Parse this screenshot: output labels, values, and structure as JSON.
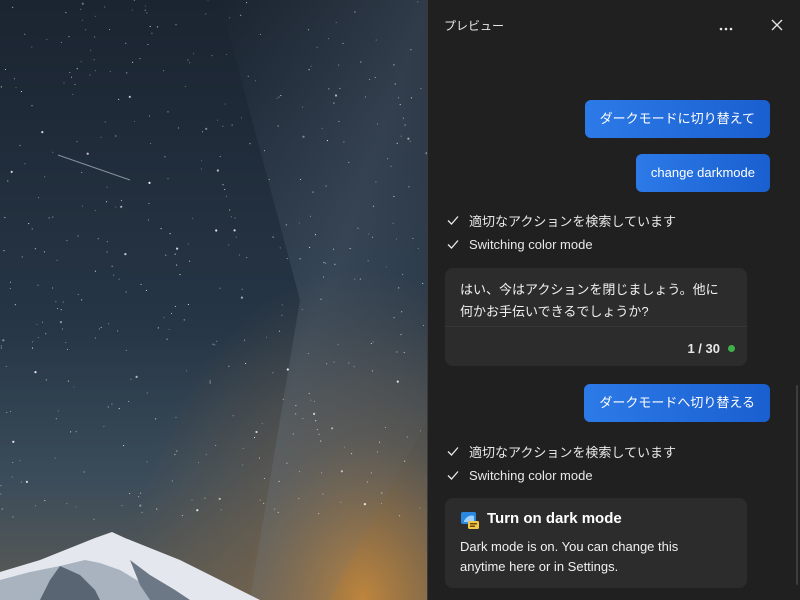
{
  "pane": {
    "title": "プレビュー",
    "more_icon": "more-horizontal-icon",
    "close_icon": "close-icon"
  },
  "conversation": {
    "user_message_1": "ダークモードに切り替えて",
    "user_message_2": "change darkmode",
    "steps_1": [
      "適切なアクションを検索しています",
      "Switching color mode"
    ],
    "bot_reply": {
      "line1": "はい、今はアクションを閉じましょう。他に",
      "line2": "何かお手伝いできるでしょうか?",
      "counter": "1 / 30",
      "status_color": "#3fb14a"
    },
    "user_message_3": "ダークモードへ切り替える",
    "steps_2": [
      "適切なアクションを検索しています",
      "Switching color mode"
    ],
    "action_card": {
      "title": "Turn on dark mode",
      "body": "Dark mode is on. You can change this anytime here or in Settings.",
      "icon": "theme-settings-icon"
    }
  },
  "colors": {
    "user_bubble": "#1f6ad9",
    "pane_background": "#202020",
    "card_background": "#2c2c2c"
  }
}
